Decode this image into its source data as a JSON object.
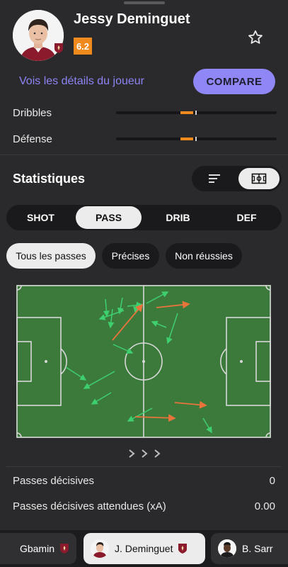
{
  "player": {
    "name": "Jessy Deminguet",
    "rating": "6.2",
    "details_link": "Vois les détails du joueur",
    "compare_label": "COMPARE"
  },
  "attributes": [
    {
      "label": "Dribbles",
      "value_fraction": 0.51
    },
    {
      "label": "Défense",
      "value_fraction": 0.51
    }
  ],
  "stats_section": {
    "title": "Statistiques",
    "view_options": [
      "list-icon",
      "pitch-icon"
    ],
    "active_view": "pitch-icon"
  },
  "segments": [
    "SHOT",
    "PASS",
    "DRIB",
    "DEF"
  ],
  "active_segment": "PASS",
  "filters": [
    "Tous les passes",
    "Précises",
    "Non réussies"
  ],
  "active_filter": "Tous les passes",
  "colors": {
    "pitch": "#3c7a3c",
    "accurate_pass": "#3ecf6e",
    "missed_pass": "#e8743c",
    "accent": "#8f87f5",
    "rating": "#f08a1c"
  },
  "stats": [
    {
      "label": "Passes décisives",
      "value": "0"
    },
    {
      "label": "Passes décisives attendues (xA)",
      "value": "0.00"
    }
  ],
  "player_tabs": [
    {
      "name": "Gbamin",
      "active": false
    },
    {
      "name": "J. Deminguet",
      "active": true
    },
    {
      "name": "B. Sarr",
      "active": false
    }
  ]
}
